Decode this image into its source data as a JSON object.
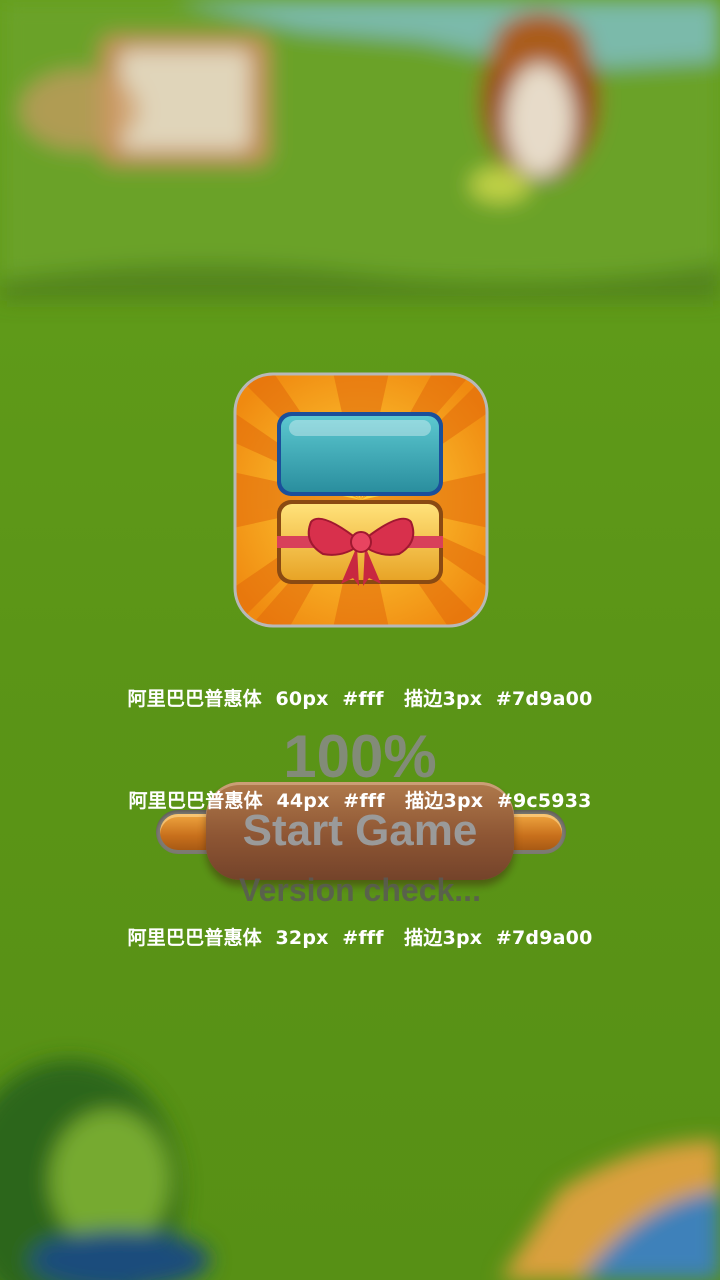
{
  "spec_labels": {
    "title": "阿里巴巴普惠体  60px  #fff   描边3px  #7d9a00",
    "button": "阿里巴巴普惠体  44px  #fff   描边3px  #9c5933",
    "version": "阿里巴巴普惠体  32px  #fff   描边3px  #7d9a00"
  },
  "loading": {
    "percent_text": "100%",
    "progress": 1.0
  },
  "start_button": {
    "label": "Start Game"
  },
  "status": {
    "version_text": "Version check..."
  },
  "colors": {
    "title_stroke": "#7d9a00",
    "button_stroke": "#9c5933",
    "version_stroke": "#7d9a00"
  }
}
